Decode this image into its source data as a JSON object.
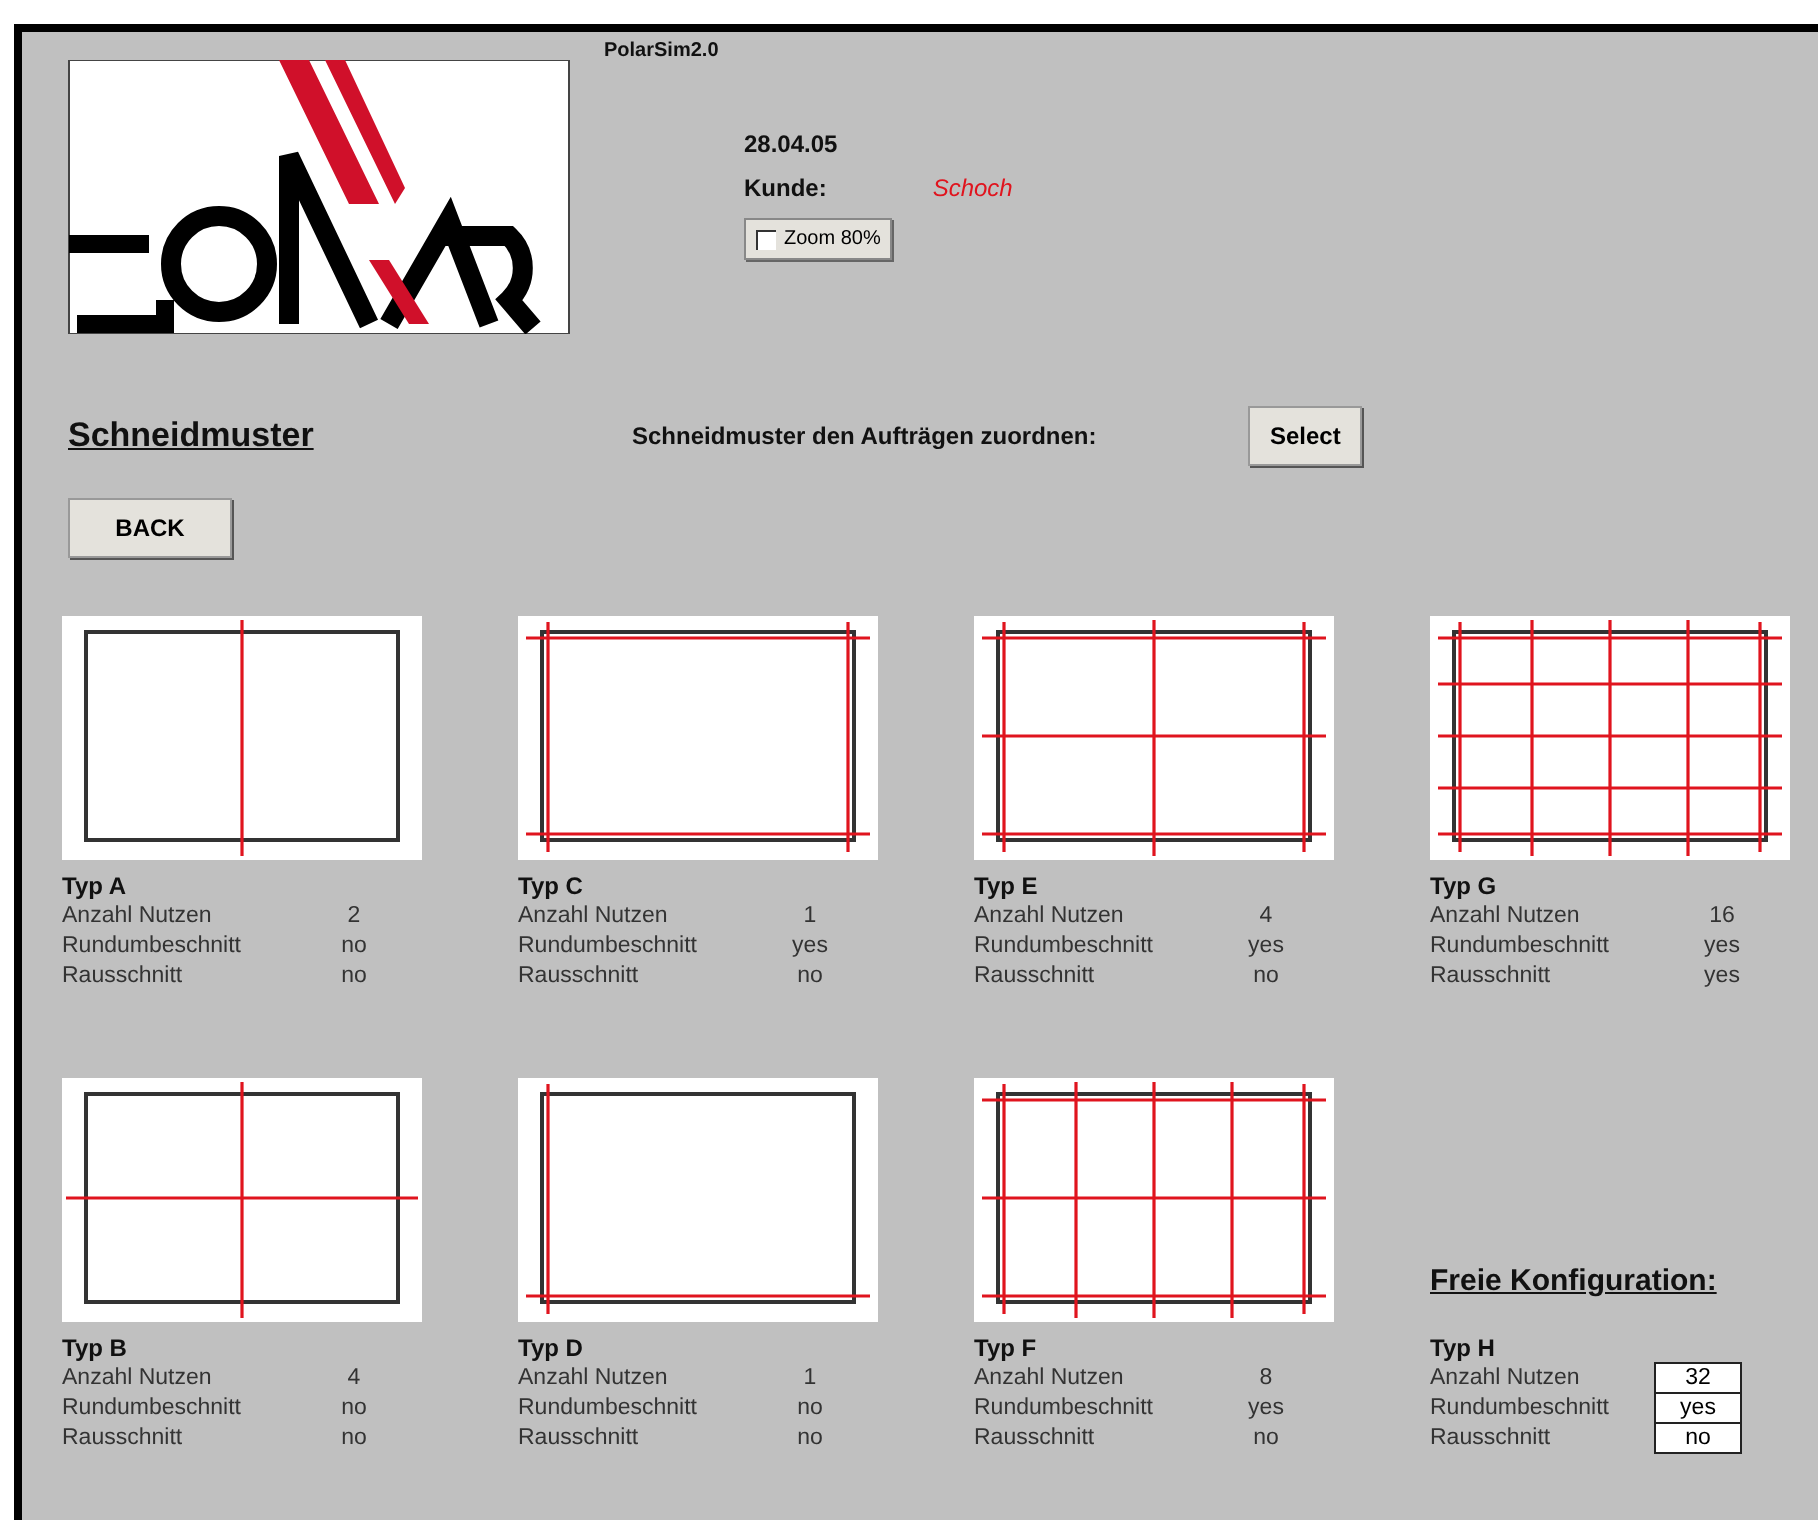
{
  "app": {
    "title": "PolarSim2.0",
    "date": "28.04.05",
    "customer_label": "Kunde:",
    "customer": "Schoch",
    "zoom": {
      "label": "Zoom 80%",
      "checked": false
    }
  },
  "section": {
    "title": "Schneidmuster",
    "assign_label": "Schneidmuster den Aufträgen zuordnen:",
    "select_button": "Select",
    "back_button": "BACK"
  },
  "patterns": [
    {
      "name": "Typ A",
      "kind": "halves",
      "props": [
        {
          "label": "Anzahl Nutzen",
          "value": "2"
        },
        {
          "label": "Rundumbeschnitt",
          "value": "no"
        },
        {
          "label": "Rausschnitt",
          "value": "no"
        }
      ]
    },
    {
      "name": "Typ C",
      "kind": "trimmed",
      "props": [
        {
          "label": "Anzahl Nutzen",
          "value": "1"
        },
        {
          "label": "Rundumbeschnitt",
          "value": "yes"
        },
        {
          "label": "Rausschnitt",
          "value": "no"
        }
      ]
    },
    {
      "name": "Typ E",
      "kind": "trimmed-quarters",
      "props": [
        {
          "label": "Anzahl Nutzen",
          "value": "4"
        },
        {
          "label": "Rundumbeschnitt",
          "value": "yes"
        },
        {
          "label": "Rausschnitt",
          "value": "no"
        }
      ]
    },
    {
      "name": "Typ G",
      "kind": "gutter-grid",
      "props": [
        {
          "label": "Anzahl Nutzen",
          "value": "16"
        },
        {
          "label": "Rundumbeschnitt",
          "value": "yes"
        },
        {
          "label": "Rausschnitt",
          "value": "yes"
        }
      ]
    },
    {
      "name": "Typ B",
      "kind": "quarters",
      "props": [
        {
          "label": "Anzahl Nutzen",
          "value": "4"
        },
        {
          "label": "Rundumbeschnitt",
          "value": "no"
        },
        {
          "label": "Rausschnitt",
          "value": "no"
        }
      ]
    },
    {
      "name": "Typ D",
      "kind": "edged",
      "props": [
        {
          "label": "Anzahl Nutzen",
          "value": "1"
        },
        {
          "label": "Rundumbeschnitt",
          "value": "no"
        },
        {
          "label": "Rausschnitt",
          "value": "no"
        }
      ]
    },
    {
      "name": "Typ F",
      "kind": "trimmed-eighths",
      "props": [
        {
          "label": "Anzahl Nutzen",
          "value": "8"
        },
        {
          "label": "Rundumbeschnitt",
          "value": "yes"
        },
        {
          "label": "Rausschnitt",
          "value": "no"
        }
      ]
    }
  ],
  "custom": {
    "title": "Freie Konfiguration:",
    "name": "Typ H",
    "props": [
      {
        "label": "Anzahl Nutzen",
        "value": "32"
      },
      {
        "label": "Rundumbeschnitt",
        "value": "yes"
      },
      {
        "label": "Rausschnitt",
        "value": "no"
      }
    ]
  }
}
